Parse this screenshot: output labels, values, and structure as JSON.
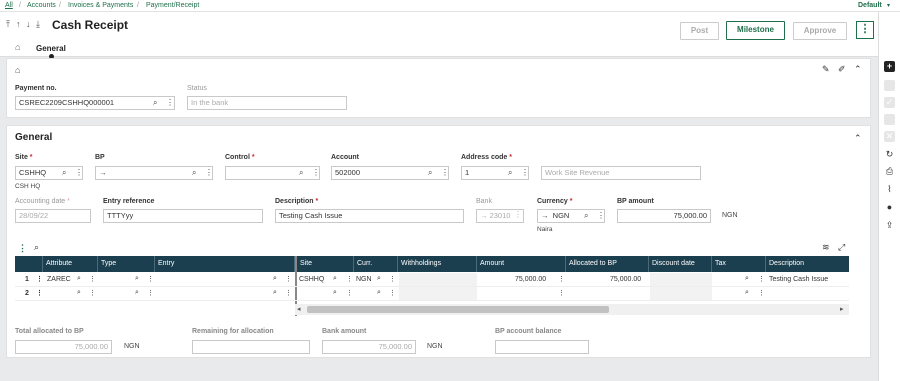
{
  "breadcrumb": {
    "all": "All",
    "accounts": "Accounts",
    "invoices": "Invoices & Payments",
    "current": "Payment/Receipt",
    "sep": "/"
  },
  "profile": "Default",
  "page": {
    "title": "Cash Receipt"
  },
  "toolbar": {
    "post": "Post",
    "milestone": "Milestone",
    "approve": "Approve"
  },
  "tabs": {
    "general": "General"
  },
  "payment": {
    "label": "Payment no.",
    "value": "CSREC2209CSHHQ000001"
  },
  "status": {
    "label": "Status",
    "value": "In the bank"
  },
  "section_title": "General",
  "site": {
    "label": "Site",
    "value": "CSHHQ",
    "sub": "CSH HQ"
  },
  "bp": {
    "label": "BP",
    "value": "→"
  },
  "control": {
    "label": "Control",
    "value": ""
  },
  "account": {
    "label": "Account",
    "value": "502000"
  },
  "address_code": {
    "label": "Address code",
    "value": "1"
  },
  "address_desc": "Work Site Revenue",
  "accounting_date": {
    "label": "Accounting date",
    "value": "28/09/22"
  },
  "entry_reference": {
    "label": "Entry reference",
    "value": "TTTYyy"
  },
  "description": {
    "label": "Description",
    "value": "Testing Cash Issue"
  },
  "bank": {
    "label": "Bank",
    "value": "→ 23010"
  },
  "currency": {
    "label": "Currency",
    "arrow": "→",
    "value": "NGN",
    "sub": "Naira"
  },
  "bp_amount": {
    "label": "BP amount",
    "value": "75,000.00",
    "currency": "NGN"
  },
  "required_mark": "*",
  "table": {
    "left_columns": [
      "Attribute",
      "Type",
      "Entry"
    ],
    "right_columns": [
      "Site",
      "Curr.",
      "Withholdings",
      "Amount",
      "Allocated to BP",
      "Discount date",
      "Tax",
      "Description"
    ],
    "rows": [
      {
        "num": "1",
        "attribute": "ZAREC",
        "type": "",
        "entry": "",
        "site": "CSHHQ",
        "curr": "NGN",
        "withholdings": "",
        "amount": "75,000.00",
        "allocated": "75,000.00",
        "discount_date": "",
        "tax": "",
        "description": "Testing Cash Issue"
      },
      {
        "num": "2",
        "attribute": "",
        "type": "",
        "entry": "",
        "site": "",
        "curr": "",
        "withholdings": "",
        "amount": "",
        "allocated": "",
        "discount_date": "",
        "tax": "",
        "description": ""
      }
    ]
  },
  "totals": {
    "allocated_label": "Total allocated to BP",
    "allocated_value": "75,000.00",
    "allocated_cur": "NGN",
    "remaining_label": "Remaining for allocation",
    "remaining_value": "",
    "bank_label": "Bank amount",
    "bank_value": "75,000.00",
    "bank_cur": "NGN",
    "balance_label": "BP account balance",
    "balance_value": ""
  },
  "colors": {
    "accent": "#1f6f4a",
    "table_header": "#1c3f50",
    "required": "#c62828"
  }
}
